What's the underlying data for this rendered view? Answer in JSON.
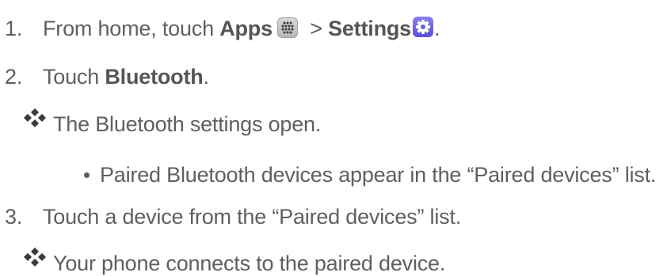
{
  "steps": [
    {
      "number": "1.",
      "prefix": "From home, touch ",
      "apps": "Apps",
      "separator": " > ",
      "settings": "Settings",
      "suffix": "."
    },
    {
      "number": "2.",
      "prefix": "Touch ",
      "target": "Bluetooth",
      "suffix": ".",
      "result": "The Bluetooth settings open.",
      "detail": "Paired Bluetooth devices appear in the “Paired devices” list."
    },
    {
      "number": "3.",
      "text": "Touch a device from the “Paired devices” list.",
      "result": "Your phone connects to the paired device."
    }
  ],
  "icons": {
    "apps": "apps-grid-icon",
    "settings": "settings-gear-icon",
    "result_bullet": "diamond-bullet-icon",
    "detail_bullet": "dot-bullet-icon"
  },
  "colors": {
    "text": "#5f5f5f",
    "settings_icon": "#6b5fe0"
  }
}
